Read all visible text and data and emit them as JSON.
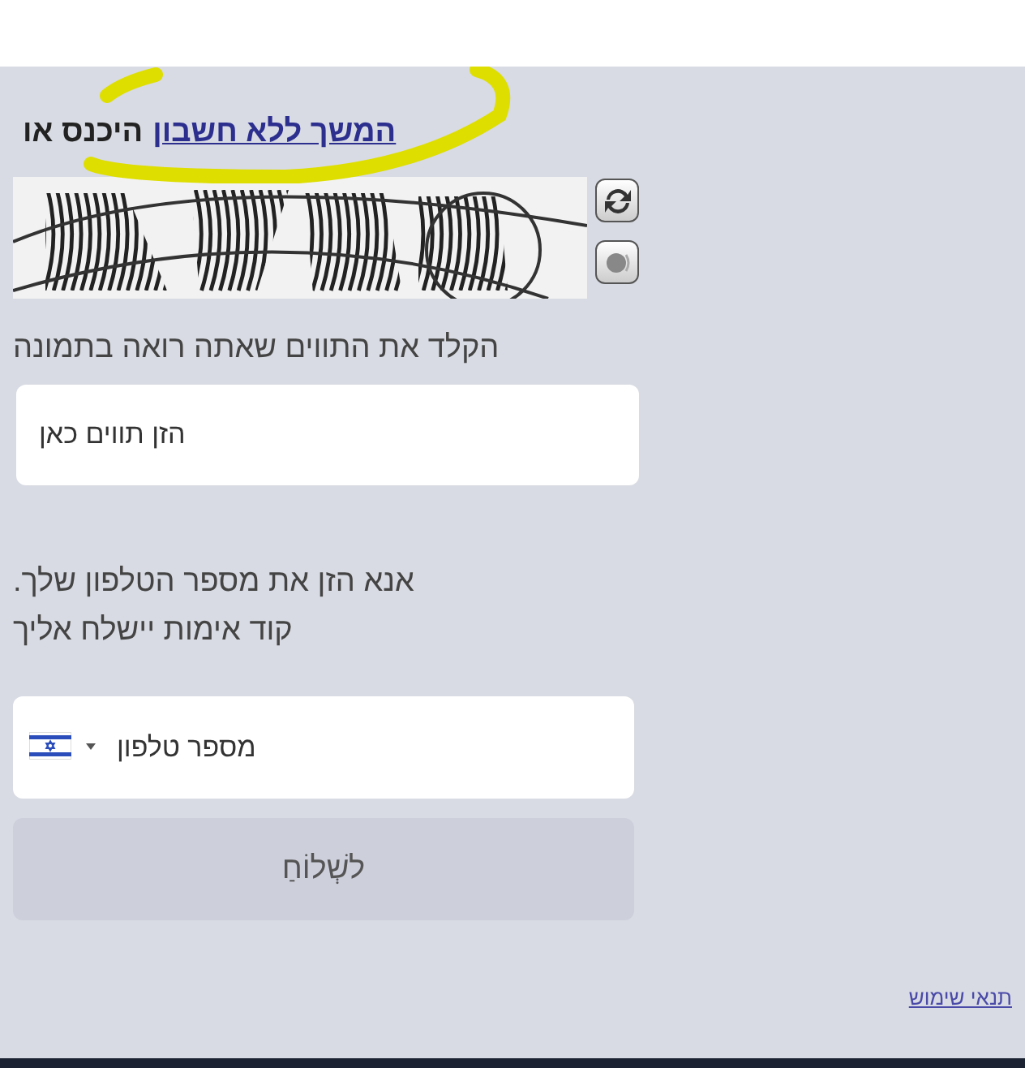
{
  "signin_prompt": {
    "link": "המשך ללא חשבון",
    "text": "היכנס או"
  },
  "captcha": {
    "label": "הקלד את התווים שאתה רואה בתמונה",
    "placeholder": "הזן תווים כאן"
  },
  "phone": {
    "instructions": "אנא הזן את מספר הטלפון שלך.\nקוד אימות יישלח אליך",
    "placeholder": "מספר טלפון"
  },
  "submit_button": {
    "label": "לשְׁלוֹחַ",
    "disabled": true
  },
  "footer": {
    "terms_link": "תנאי שימוש"
  }
}
